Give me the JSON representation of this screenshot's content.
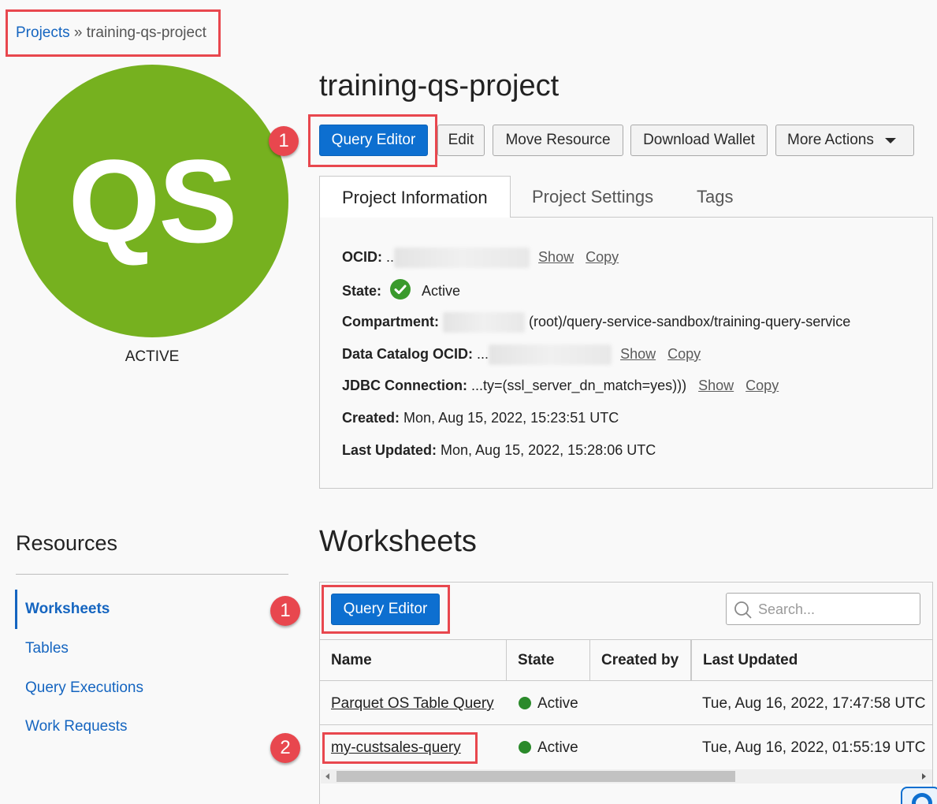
{
  "breadcrumb": {
    "root": "Projects",
    "separator": "»",
    "current": "training-qs-project"
  },
  "avatar": {
    "initials": "QS",
    "color": "#76b11f",
    "status": "ACTIVE"
  },
  "project": {
    "title": "training-qs-project"
  },
  "toolbar": {
    "query_editor": "Query Editor",
    "edit": "Edit",
    "move_resource": "Move Resource",
    "download_wallet": "Download Wallet",
    "more_actions": "More Actions"
  },
  "tabs": [
    "Project Information",
    "Project Settings",
    "Tags"
  ],
  "info": {
    "ocid_label": "OCID:",
    "ocid_value": "..",
    "compartment_label": "Compartment:",
    "compartment_value": "(root)/query-service-sandbox/training-query-service",
    "state_label": "State:",
    "state_value": "Active",
    "catalog_label": "Data Catalog OCID:",
    "catalog_value": "...",
    "jdbc_label": "JDBC Connection:",
    "jdbc_value": "...ty=(ssl_server_dn_match=yes)))",
    "created_label": "Created:",
    "created_value": "Mon, Aug 15, 2022, 15:23:51 UTC",
    "updated_label": "Last Updated:",
    "updated_value": "Mon, Aug 15, 2022, 15:28:06 UTC",
    "show": "Show",
    "copy": "Copy"
  },
  "callouts": {
    "one": "1",
    "two": "2"
  },
  "resources": {
    "title": "Resources",
    "items": [
      "Worksheets",
      "Tables",
      "Query Executions",
      "Work Requests"
    ]
  },
  "worksheets": {
    "title": "Worksheets",
    "query_editor": "Query Editor",
    "search_placeholder": "Search...",
    "columns": [
      "Name",
      "State",
      "Created by",
      "Last Updated"
    ],
    "rows": [
      {
        "name": "Parquet OS Table Query",
        "state": "Active",
        "created_by": "",
        "updated": "Tue, Aug 16, 2022, 17:47:58 UTC"
      },
      {
        "name": "my-custsales-query",
        "state": "Active",
        "created_by": "",
        "updated": "Tue, Aug 16, 2022, 01:55:19 UTC"
      }
    ]
  },
  "colors": {
    "primary": "#0d6fd0",
    "callout": "#e8474e",
    "active": "#2b8a2b"
  }
}
